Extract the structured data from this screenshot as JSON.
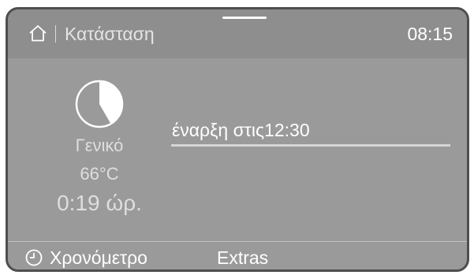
{
  "header": {
    "home_icon": "home-icon",
    "title": "Κατάσταση",
    "time": "08:15"
  },
  "program": {
    "icon": "program-progress-pie-icon",
    "name": "Γενικό",
    "temperature": "66°C",
    "duration": "0:19 ώρ."
  },
  "start": {
    "text": "έναρξη στις12:30"
  },
  "footer": {
    "timer_icon": "clock-icon",
    "timer_label": "Χρονόμετρο",
    "extras_label": "Extras"
  },
  "colors": {
    "screen_background": "#9a9a9a",
    "header_background": "#8e8e8e",
    "bezel": "#4e4e4e",
    "text_primary": "#ffffff",
    "text_secondary": "#dedede"
  }
}
